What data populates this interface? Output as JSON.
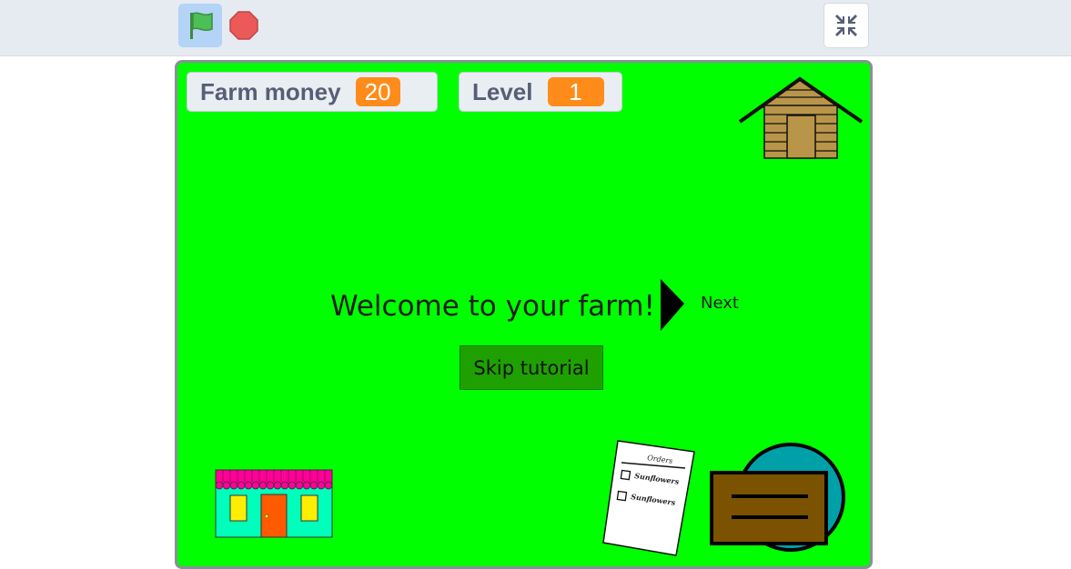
{
  "toolbar": {
    "green_flag_icon": "green-flag-icon",
    "stop_icon": "stop-sign-icon",
    "fullscreen_icon": "exit-fullscreen-icon"
  },
  "monitors": {
    "farm_money": {
      "label": "Farm money",
      "value": "20"
    },
    "level": {
      "label": "Level",
      "value": "1"
    }
  },
  "stage": {
    "welcome_text": "Welcome to your farm!",
    "next_label": "Next",
    "skip_label": "Skip tutorial"
  },
  "orders": {
    "title": "Orders",
    "items": [
      "Sunflowers",
      "Sunflowers"
    ]
  },
  "colors": {
    "stage_bg": "#00ff00",
    "monitor_value_bg": "#ff8c1a",
    "skip_button_bg": "#1ea100",
    "topbar_bg": "#e6ebf1"
  }
}
